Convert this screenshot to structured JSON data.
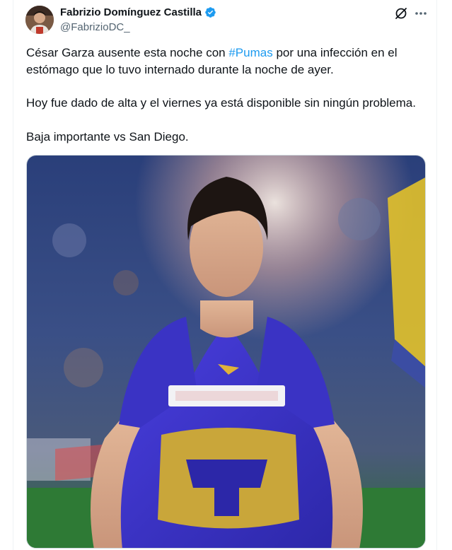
{
  "author": {
    "display_name": "Fabrizio Domínguez Castilla",
    "handle": "@FabrizioDC_",
    "verified": true
  },
  "icons": {
    "verified": "verified-badge-icon",
    "grok": "grok-icon",
    "more": "more-horizontal-icon"
  },
  "colors": {
    "link": "#1d9bf0",
    "verified": "#1d9bf0",
    "text": "#0f1419",
    "secondary": "#536471",
    "jersey": "#3a33c4",
    "crest": "#c9a63a"
  },
  "tweet": {
    "p1_before": "César Garza ausente esta noche con ",
    "hashtag": "#Pumas",
    "p1_after": " por una infección en el estómago que lo tuvo internado durante la noche de ayer.",
    "p2": "Hoy fue dado de alta y el viernes ya está disponible sin ningún problema.",
    "p3": "Baja importante vs San Diego."
  }
}
